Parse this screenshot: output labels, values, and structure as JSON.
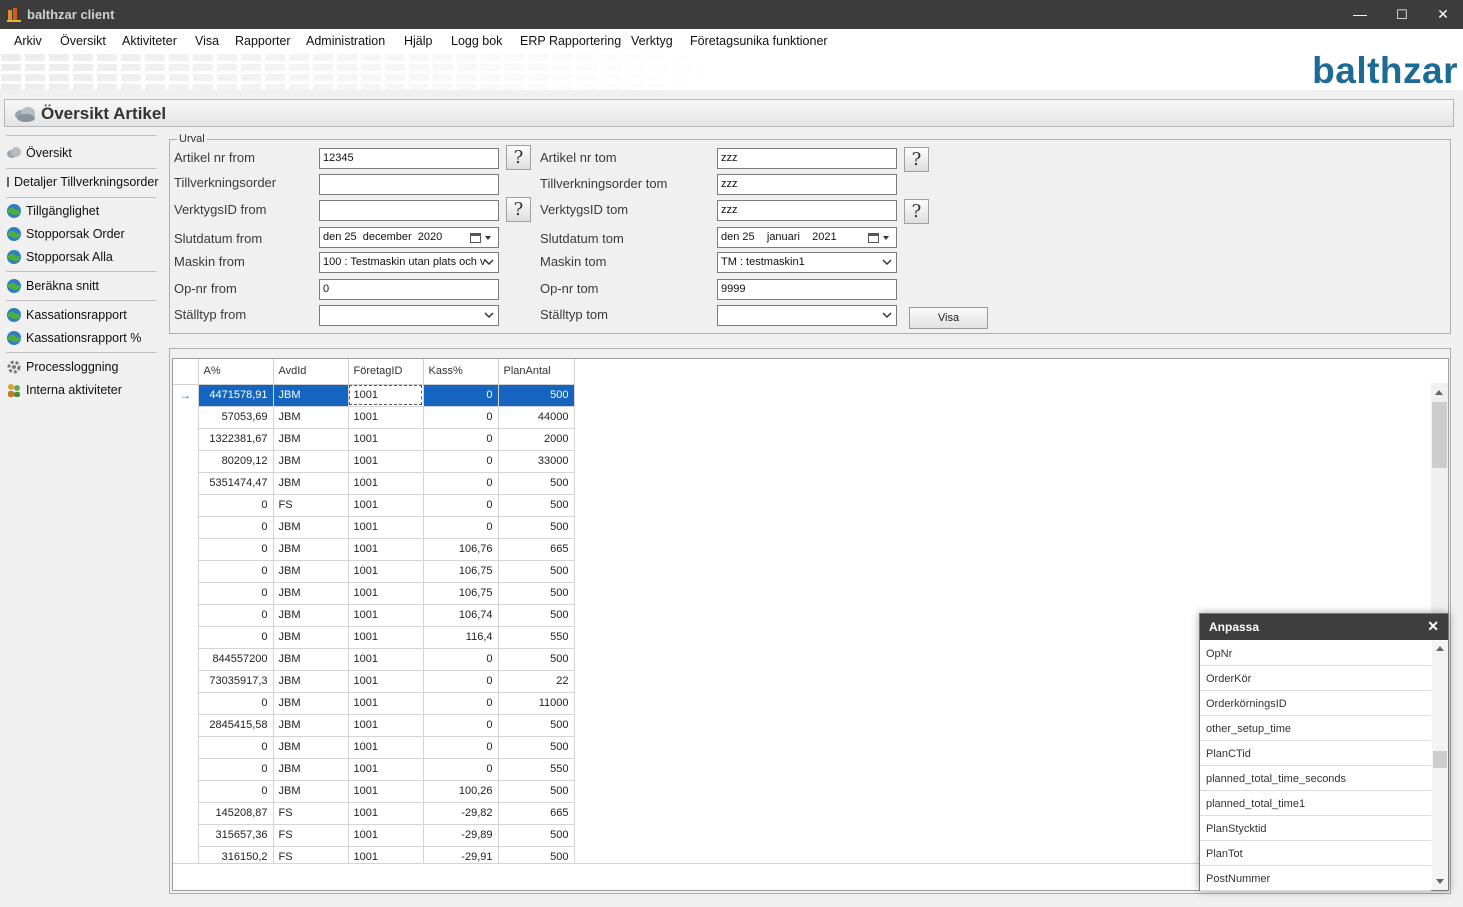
{
  "window": {
    "title": "balthzar client",
    "minimize": "—",
    "maximize": "☐",
    "close": "✕"
  },
  "menu": [
    "Arkiv",
    "Översikt",
    "Aktiviteter",
    "Visa",
    "Rapporter",
    "Administration",
    "Hjälp",
    "Logg bok",
    "ERP Rapportering",
    "Verktyg",
    "Företagsunika funktioner"
  ],
  "brand": "balthzar",
  "page_title": "Översikt Artikel",
  "sidebar": [
    {
      "label": "Översikt",
      "icon": "cloud-icon"
    },
    {
      "label": "Detaljer Tillverkningsorder",
      "icon": "detail-icon"
    },
    {
      "label": "Tillgänglighet",
      "icon": "globe-icon"
    },
    {
      "label": "Stopporsak Order",
      "icon": "globe-icon"
    },
    {
      "label": "Stopporsak Alla",
      "icon": "globe-icon"
    },
    {
      "label": "Beräkna snitt",
      "icon": "globe-icon"
    },
    {
      "label": "Kassationsrapport",
      "icon": "globe-icon"
    },
    {
      "label": "Kassationsrapport %",
      "icon": "globe-icon"
    },
    {
      "label": "Processloggning",
      "icon": "gear-icon"
    },
    {
      "label": "Interna aktiviteter",
      "icon": "people-icon"
    }
  ],
  "urval": {
    "legend": "Urval",
    "artikel_from_label": "Artikel nr from",
    "artikel_from": "12345",
    "artikel_tom_label": "Artikel nr tom",
    "artikel_tom": "zzz",
    "order_from_label": "Tillverkningsorder",
    "order_from": "",
    "order_tom_label": "Tillverkningsorder tom",
    "order_tom": "zzz",
    "verktyg_from_label": "VerktygsID from",
    "verktyg_from": "",
    "verktyg_tom_label": "VerktygsID tom",
    "verktyg_tom": "zzz",
    "slut_from_label": "Slutdatum from",
    "slut_from": "den 25  december  2020",
    "slut_tom_label": "Slutdatum tom",
    "slut_tom": "den 25    januari    2021",
    "maskin_from_label": "Maskin from",
    "maskin_from": "100 : Testmaskin utan plats och v",
    "maskin_tom_label": "Maskin tom",
    "maskin_tom": "TM : testmaskin1",
    "opnr_from_label": "Op-nr from",
    "opnr_from": "0",
    "opnr_tom_label": "Op-nr tom",
    "opnr_tom": "9999",
    "stall_from_label": "Ställtyp from",
    "stall_from": "",
    "stall_tom_label": "Ställtyp tom",
    "stall_tom": "",
    "help": "?",
    "visa": "Visa"
  },
  "grid": {
    "columns": [
      "A%",
      "AvdId",
      "FöretagID",
      "Kass%",
      "PlanAntal"
    ],
    "rows": [
      [
        "4471578,91",
        "JBM",
        "1001",
        "0",
        "500"
      ],
      [
        "57053,69",
        "JBM",
        "1001",
        "0",
        "44000"
      ],
      [
        "1322381,67",
        "JBM",
        "1001",
        "0",
        "2000"
      ],
      [
        "80209,12",
        "JBM",
        "1001",
        "0",
        "33000"
      ],
      [
        "5351474,47",
        "JBM",
        "1001",
        "0",
        "500"
      ],
      [
        "0",
        "FS",
        "1001",
        "0",
        "500"
      ],
      [
        "0",
        "JBM",
        "1001",
        "0",
        "500"
      ],
      [
        "0",
        "JBM",
        "1001",
        "106,76",
        "665"
      ],
      [
        "0",
        "JBM",
        "1001",
        "106,75",
        "500"
      ],
      [
        "0",
        "JBM",
        "1001",
        "106,75",
        "500"
      ],
      [
        "0",
        "JBM",
        "1001",
        "106,74",
        "500"
      ],
      [
        "0",
        "JBM",
        "1001",
        "116,4",
        "550"
      ],
      [
        "844557200",
        "JBM",
        "1001",
        "0",
        "500"
      ],
      [
        "73035917,3",
        "JBM",
        "1001",
        "0",
        "22"
      ],
      [
        "0",
        "JBM",
        "1001",
        "0",
        "11000"
      ],
      [
        "2845415,58",
        "JBM",
        "1001",
        "0",
        "500"
      ],
      [
        "0",
        "JBM",
        "1001",
        "0",
        "500"
      ],
      [
        "0",
        "JBM",
        "1001",
        "0",
        "550"
      ],
      [
        "0",
        "JBM",
        "1001",
        "100,26",
        "500"
      ],
      [
        "145208,87",
        "FS",
        "1001",
        "-29,82",
        "665"
      ],
      [
        "315657,36",
        "FS",
        "1001",
        "-29,89",
        "500"
      ],
      [
        "316150,2",
        "FS",
        "1001",
        "-29,91",
        "500"
      ]
    ],
    "row_indicator": "→"
  },
  "anpassa": {
    "title": "Anpassa",
    "close": "✕",
    "items": [
      "OpNr",
      "OrderKör",
      "OrderkörningsID",
      "other_setup_time",
      "PlanCTid",
      "planned_total_time_seconds",
      "planned_total_time1",
      "PlanStycktid",
      "PlanTot",
      "PostNummer"
    ]
  },
  "colors": {
    "selection": "#1565c0",
    "brand": "#1b6b95",
    "titlebar": "#3c3c3c"
  }
}
